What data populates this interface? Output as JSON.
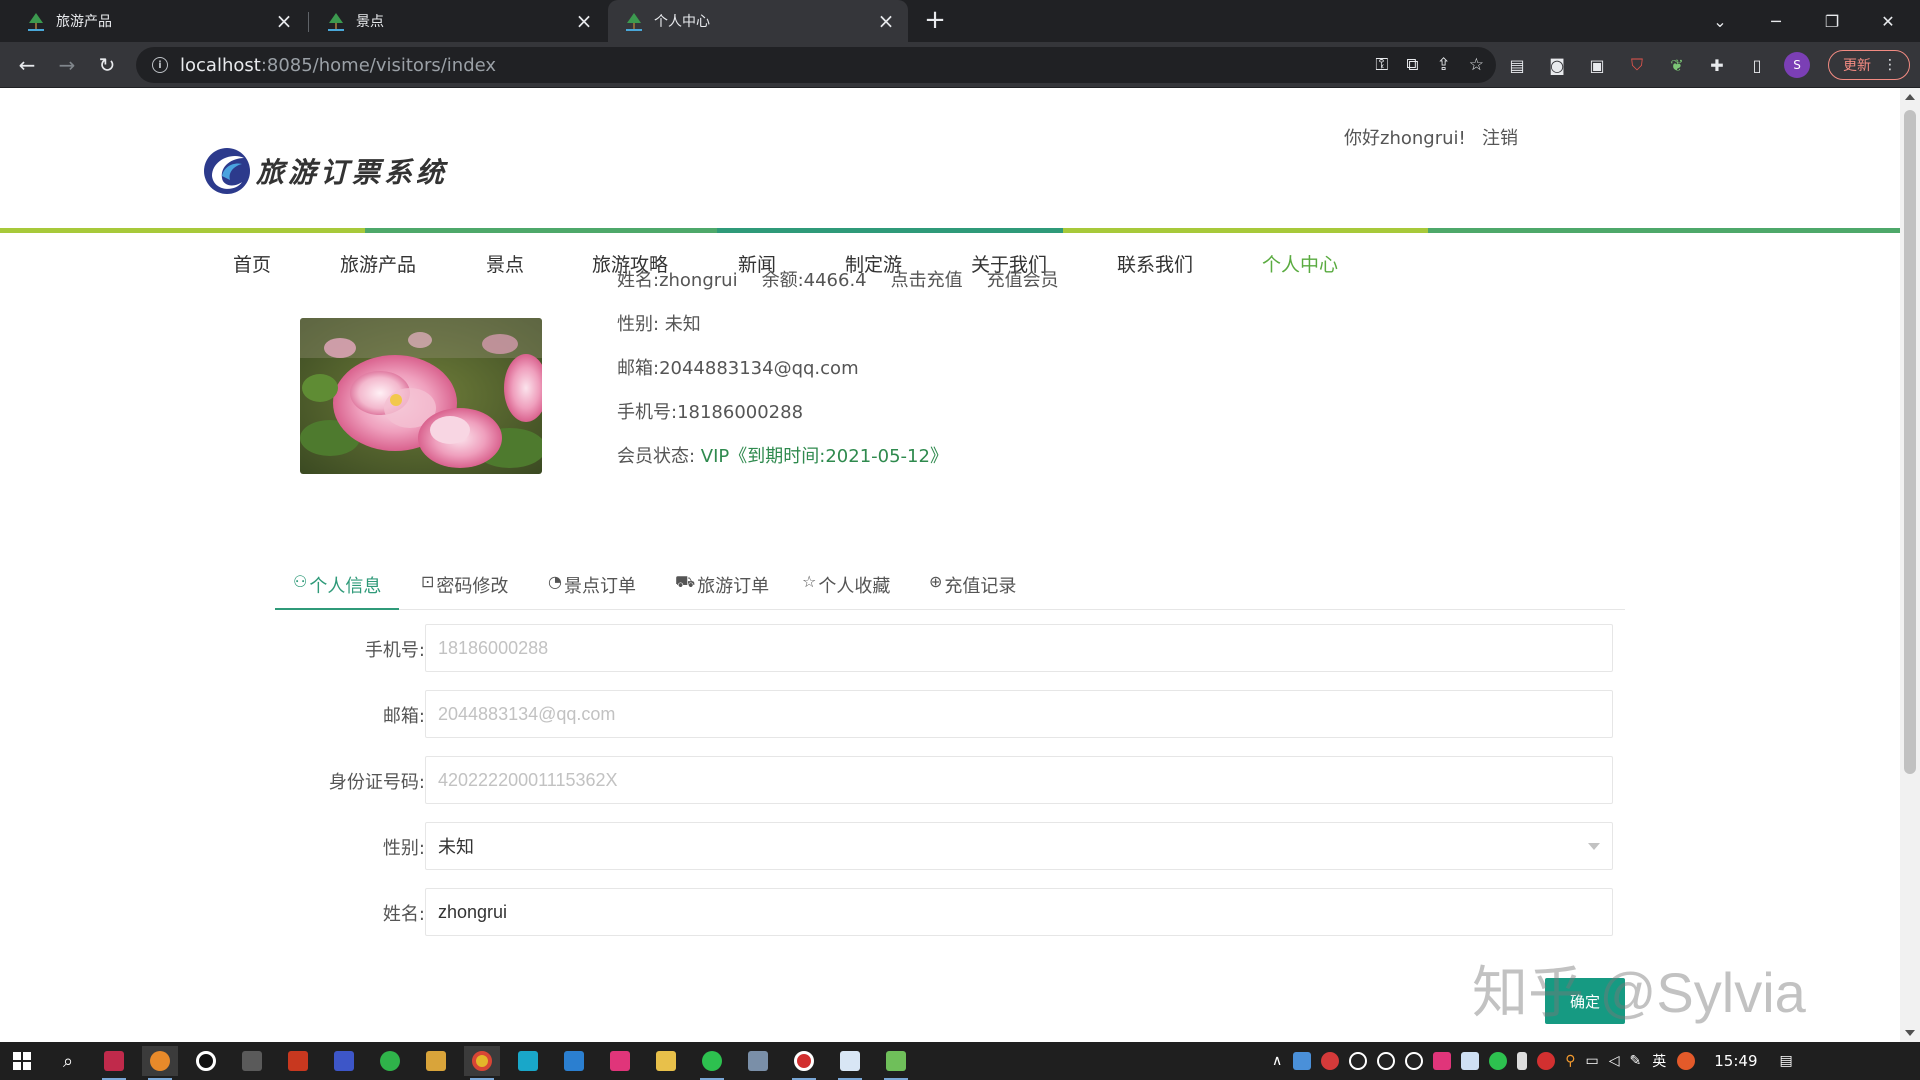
{
  "browser": {
    "tabs": [
      {
        "title": "旅游产品",
        "active": false
      },
      {
        "title": "景点",
        "active": false
      },
      {
        "title": "个人中心",
        "active": true
      }
    ],
    "url_host": "localhost",
    "url_rest": ":8085/home/visitors/index",
    "update_label": "更新",
    "profile_initial": "S"
  },
  "header": {
    "logo_text": "旅游订票系统",
    "greeting": "你好zhongrui!",
    "logout": "注销"
  },
  "colors": {
    "accent_green": "#5aab40",
    "tab_active": "#2f9a79",
    "vip_green": "#2f8a4e",
    "button": "#169a82",
    "stripe": [
      "#a7c93a",
      "#4ea86a",
      "#2f9a79",
      "#a7c93a",
      "#4ea86a"
    ]
  },
  "nav": {
    "items": [
      "首页",
      "旅游产品",
      "景点",
      "旅游攻略",
      "新闻",
      "制定游",
      "关于我们",
      "联系我们",
      "个人中心"
    ],
    "active_index": 8
  },
  "profile": {
    "name": "姓名:zhongrui",
    "balance": "余额:4466.4",
    "recharge": "点击充值",
    "vip_recharge": "充值会员",
    "gender": "性别: 未知",
    "email": "邮箱:2044883134@qq.com",
    "phone": "手机号:18186000288",
    "member_label": "会员状态: ",
    "member_value": "VIP《到期时间:2021-05-12》"
  },
  "user_tabs": [
    {
      "icon": "user-icon",
      "label": "个人信息",
      "active": true
    },
    {
      "icon": "lock-icon",
      "label": "密码修改",
      "active": false
    },
    {
      "icon": "ticket-icon",
      "label": "景点订单",
      "active": false
    },
    {
      "icon": "cart-icon",
      "label": "旅游订单",
      "active": false
    },
    {
      "icon": "star-icon",
      "label": "个人收藏",
      "active": false
    },
    {
      "icon": "yen-icon",
      "label": "充值记录",
      "active": false
    }
  ],
  "form": {
    "phone_label": "手机号:",
    "phone_placeholder": "18186000288",
    "email_label": "邮箱:",
    "email_placeholder": "2044883134@qq.com",
    "idcard_label": "身份证号码:",
    "idcard_placeholder": "42022220001115362X",
    "gender_label": "性别:",
    "gender_value": "未知",
    "name_label": "姓名:",
    "name_value": "zhongrui",
    "confirm": "确定"
  },
  "watermark": "知乎 @Sylvia",
  "taskbar": {
    "lang": "英",
    "time": "15:49"
  }
}
